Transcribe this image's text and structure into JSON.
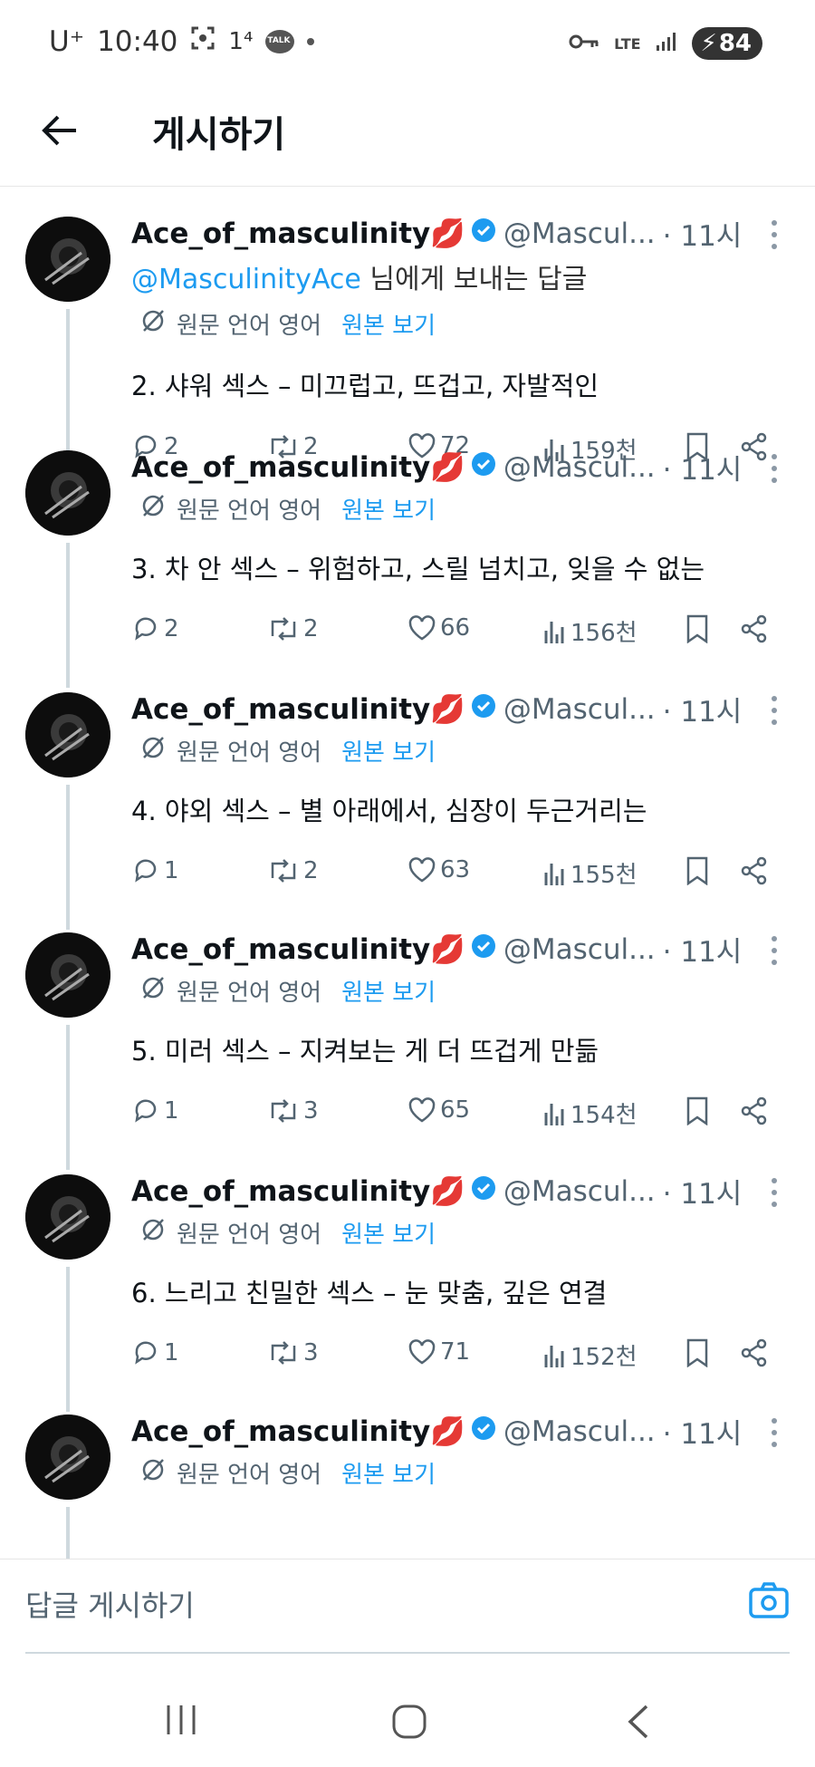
{
  "status_bar": {
    "carrier": "U⁺",
    "time": "10:40",
    "notif_count": "1⁴",
    "kakao_label": "TALK",
    "network": "LTE",
    "battery": "84"
  },
  "header": {
    "title": "게시하기"
  },
  "translation": {
    "lang_label": "원문 언어 영어",
    "show_original": "원본 보기"
  },
  "author": {
    "name": "Ace_of_masculinity",
    "emoji": "💋",
    "handle": "@Mascul...",
    "time": "· 11시"
  },
  "reply_to": {
    "mention": "@MasculinityAce",
    "suffix": " 님에게 보내는 답글"
  },
  "tweets": [
    {
      "text": "2. 샤워 섹스 – 미끄럽고, 뜨겁고, 자발적인",
      "replies": "2",
      "retweets": "2",
      "likes": "72",
      "views": "159천"
    },
    {
      "text": "3. 차 안 섹스 – 위험하고, 스릴 넘치고, 잊을 수 없는",
      "replies": "2",
      "retweets": "2",
      "likes": "66",
      "views": "156천"
    },
    {
      "text": "4. 야외 섹스 – 별 아래에서, 심장이 두근거리는",
      "replies": "1",
      "retweets": "2",
      "likes": "63",
      "views": "155천"
    },
    {
      "text": "5. 미러 섹스 – 지켜보는 게 더 뜨겁게 만듦",
      "replies": "1",
      "retweets": "3",
      "likes": "65",
      "views": "154천"
    },
    {
      "text": "6. 느리고 친밀한 섹스 – 눈 맞춤, 깊은 연결",
      "replies": "1",
      "retweets": "3",
      "likes": "71",
      "views": "152천"
    }
  ],
  "composer": {
    "placeholder": "답글 게시하기"
  },
  "colors": {
    "accent": "#1d9bf0",
    "muted": "#536471",
    "verified": "#1d9bf0"
  }
}
